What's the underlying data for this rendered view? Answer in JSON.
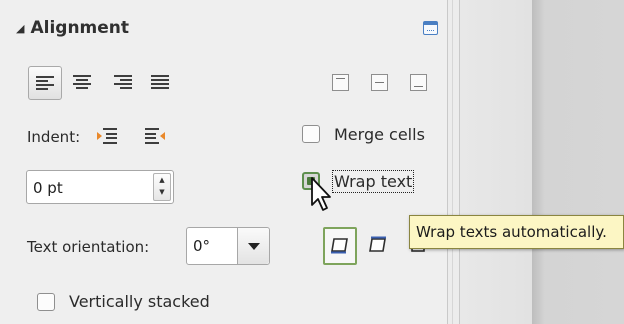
{
  "section": {
    "title": "Alignment",
    "collapse_glyph": "◢"
  },
  "labels": {
    "indent": "Indent:",
    "merge_cells": "Merge cells",
    "wrap_text": "Wrap text",
    "text_orientation": "Text orientation:",
    "vertically_stacked": "Vertically stacked"
  },
  "indent_spin": {
    "value": "0 pt",
    "up_glyph": "▲",
    "down_glyph": "▼"
  },
  "orientation_combo": {
    "value": "0°"
  },
  "checkboxes": {
    "merge_cells": false,
    "wrap_text": "focused",
    "vertically_stacked": false
  },
  "tooltip": {
    "text": "Wrap texts automatically."
  },
  "colors": {
    "accent_green": "#7ea45c",
    "tooltip_bg": "#fcf6c4",
    "more_options_blue": "#4a7fc3"
  },
  "icons": [
    "align-left-icon",
    "align-center-icon",
    "align-right-icon",
    "align-justify-icon",
    "align-top-icon",
    "align-middle-icon",
    "align-bottom-icon",
    "increase-indent-icon",
    "decrease-indent-icon",
    "orientation-bottom-icon",
    "orientation-top-icon",
    "orientation-stacked-icon"
  ]
}
